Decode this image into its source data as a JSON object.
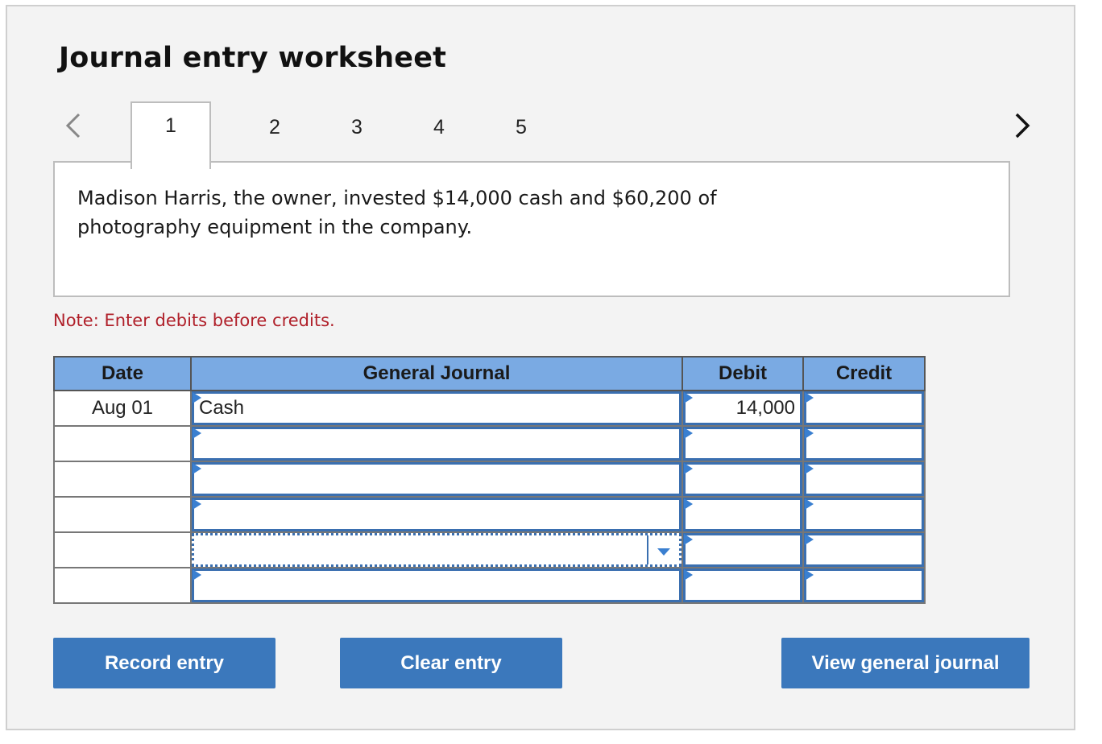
{
  "header": {
    "title": "Journal entry worksheet"
  },
  "tabs": [
    {
      "label": "1",
      "active": true
    },
    {
      "label": "2",
      "active": false
    },
    {
      "label": "3",
      "active": false
    },
    {
      "label": "4",
      "active": false
    },
    {
      "label": "5",
      "active": false
    }
  ],
  "nav": {
    "prev_icon": "chevron-left-icon",
    "next_icon": "chevron-right-icon"
  },
  "description": "Madison Harris, the owner, invested $14,000 cash and $60,200 of photography equipment in the company.",
  "note": "Note: Enter debits before credits.",
  "journal": {
    "headers": {
      "date": "Date",
      "account": "General Journal",
      "debit": "Debit",
      "credit": "Credit"
    },
    "rows": [
      {
        "date": "Aug 01",
        "account": "Cash",
        "debit": "14,000",
        "credit": ""
      },
      {
        "date": "",
        "account": "",
        "debit": "",
        "credit": ""
      },
      {
        "date": "",
        "account": "",
        "debit": "",
        "credit": ""
      },
      {
        "date": "",
        "account": "",
        "debit": "",
        "credit": ""
      },
      {
        "date": "",
        "account": "",
        "debit": "",
        "credit": ""
      },
      {
        "date": "",
        "account": "",
        "debit": "",
        "credit": ""
      }
    ]
  },
  "buttons": {
    "record": "Record entry",
    "clear": "Clear entry",
    "view": "View general journal"
  },
  "colors": {
    "accent": "#3b78bc",
    "header_bg": "#7aaae3",
    "note": "#b0202a",
    "field_border": "#3a6fb0"
  }
}
